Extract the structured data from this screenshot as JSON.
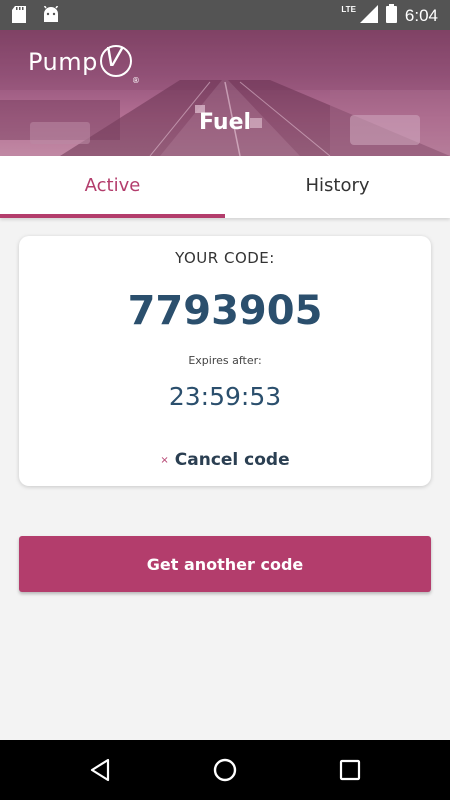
{
  "status_bar": {
    "time": "6:04",
    "network": "LTE",
    "icons": [
      "sd-card-icon",
      "android-icon",
      "signal-icon",
      "battery-icon"
    ]
  },
  "header": {
    "logo_text": "Pump",
    "logo_mark": "V",
    "logo_reg": "®",
    "title": "Fuel"
  },
  "tabs": [
    {
      "label": "Active",
      "selected": true
    },
    {
      "label": "History",
      "selected": false
    }
  ],
  "code_card": {
    "label": "YOUR CODE:",
    "code": "7793905",
    "expires_label": "Expires after:",
    "expires_value": "23:59:53",
    "cancel_icon": "×",
    "cancel_label": "Cancel code"
  },
  "actions": {
    "get_another_code": "Get another code"
  },
  "navigation": {
    "buttons": [
      "back-icon",
      "home-icon",
      "recents-icon"
    ]
  },
  "colors": {
    "accent": "#b33d6c",
    "code_text": "#2b4f6d",
    "status_bar": "#545454"
  }
}
